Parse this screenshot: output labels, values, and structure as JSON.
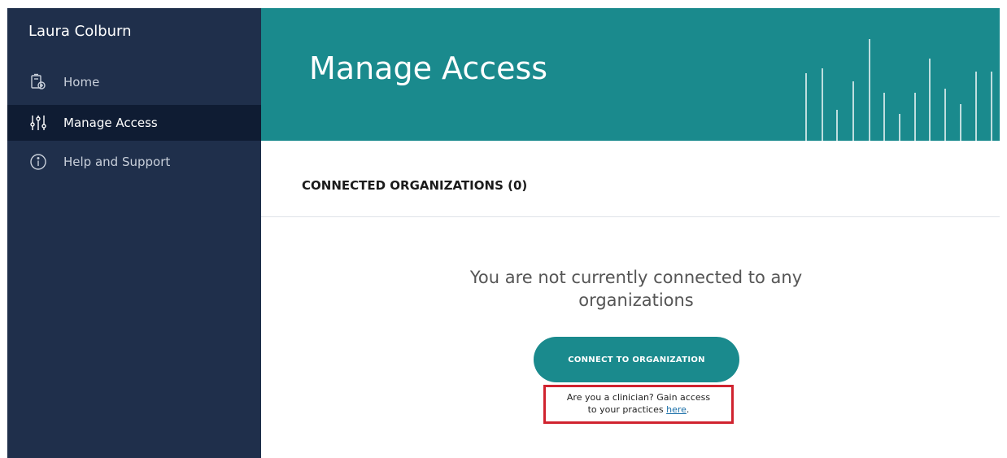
{
  "sidebar": {
    "user_name": "Laura Colburn",
    "items": [
      {
        "label": "Home",
        "icon": "clipboard-icon",
        "active": false
      },
      {
        "label": "Manage Access",
        "icon": "sliders-icon",
        "active": true
      },
      {
        "label": "Help and Support",
        "icon": "info-icon",
        "active": false
      }
    ]
  },
  "header": {
    "title": "Manage Access"
  },
  "main": {
    "section_title": "CONNECTED ORGANIZATIONS (0)",
    "empty_message": "You are not currently connected to any organizations",
    "connect_button_label": "CONNECT TO ORGANIZATION",
    "clinician_text_line1": "Are you a clinician? Gain access",
    "clinician_text_line2": "to your practices ",
    "clinician_link_label": "here",
    "clinician_text_end": "."
  },
  "colors": {
    "sidebar_bg": "#1f2f4b",
    "sidebar_active_bg": "#0f1c33",
    "accent_teal": "#1a8a8d",
    "highlight_red": "#d0232f",
    "link_blue": "#1a6fa8"
  }
}
